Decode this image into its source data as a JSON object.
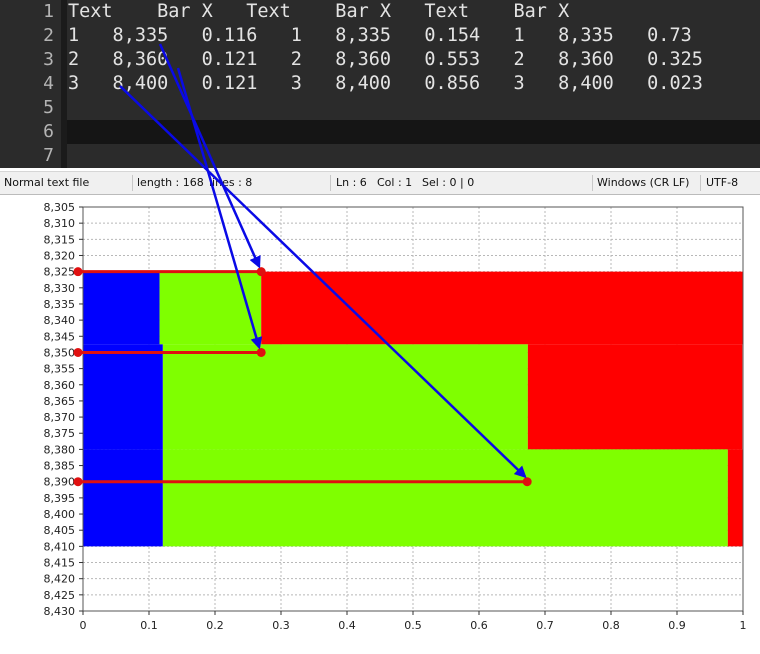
{
  "editor": {
    "line_numbers": [
      "1",
      "2",
      "3",
      "4",
      "5",
      "6",
      "7"
    ],
    "lines": [
      "Text    Bar X   Text    Bar X   Text    Bar X",
      "1   8,335   0.116   1   8,335   0.154   1   8,335   0.73",
      "2   8,360   0.121   2   8,360   0.553   2   8,360   0.325",
      "3   8,400   0.121   3   8,400   0.856   3   8,400   0.023",
      "",
      "",
      ""
    ]
  },
  "statusbar": {
    "file_type": "Normal text file",
    "length": "length : 168",
    "lines": "lines : 8",
    "ln": "Ln : 6",
    "col": "Col : 1",
    "sel": "Sel : 0 | 0",
    "eol": "Windows (CR LF)",
    "encoding": "UTF-8"
  },
  "colors": {
    "series_blue": "#0000ff",
    "series_green": "#7fff00",
    "series_red": "#ff0000",
    "arrow": "#0a0ae6",
    "marker": "#e01010"
  },
  "chart_data": {
    "type": "bar",
    "orientation": "horizontal-stacked",
    "x": [
      8335,
      8360,
      8400
    ],
    "series": [
      {
        "color": "#0000ff",
        "values": [
          0.116,
          0.121,
          0.121
        ]
      },
      {
        "color": "#7fff00",
        "values": [
          0.154,
          0.553,
          0.856
        ]
      },
      {
        "color": "#ff0000",
        "values": [
          0.73,
          0.325,
          0.023
        ]
      }
    ],
    "xlim": [
      0,
      1
    ],
    "ylim": [
      8305,
      8430
    ],
    "x_ticks": [
      "0",
      "0.1",
      "0.2",
      "0.3",
      "0.4",
      "0.5",
      "0.6",
      "0.7",
      "0.8",
      "0.9",
      "1"
    ],
    "y_ticks": [
      "8,305",
      "8,310",
      "8,315",
      "8,320",
      "8,325",
      "8,330",
      "8,335",
      "8,340",
      "8,345",
      "8,350",
      "8,355",
      "8,360",
      "8,365",
      "8,370",
      "8,375",
      "8,380",
      "8,385",
      "8,390",
      "8,395",
      "8,400",
      "8,405",
      "8,410",
      "8,415",
      "8,420",
      "8,425",
      "8,430"
    ],
    "grid": true,
    "annotations": [
      {
        "kind": "marker-line",
        "y": 8325,
        "x_end": 0.27
      },
      {
        "kind": "marker-line",
        "y": 8350,
        "x_end": 0.27
      },
      {
        "kind": "marker-line",
        "y": 8390,
        "x_end": 0.673
      }
    ]
  }
}
